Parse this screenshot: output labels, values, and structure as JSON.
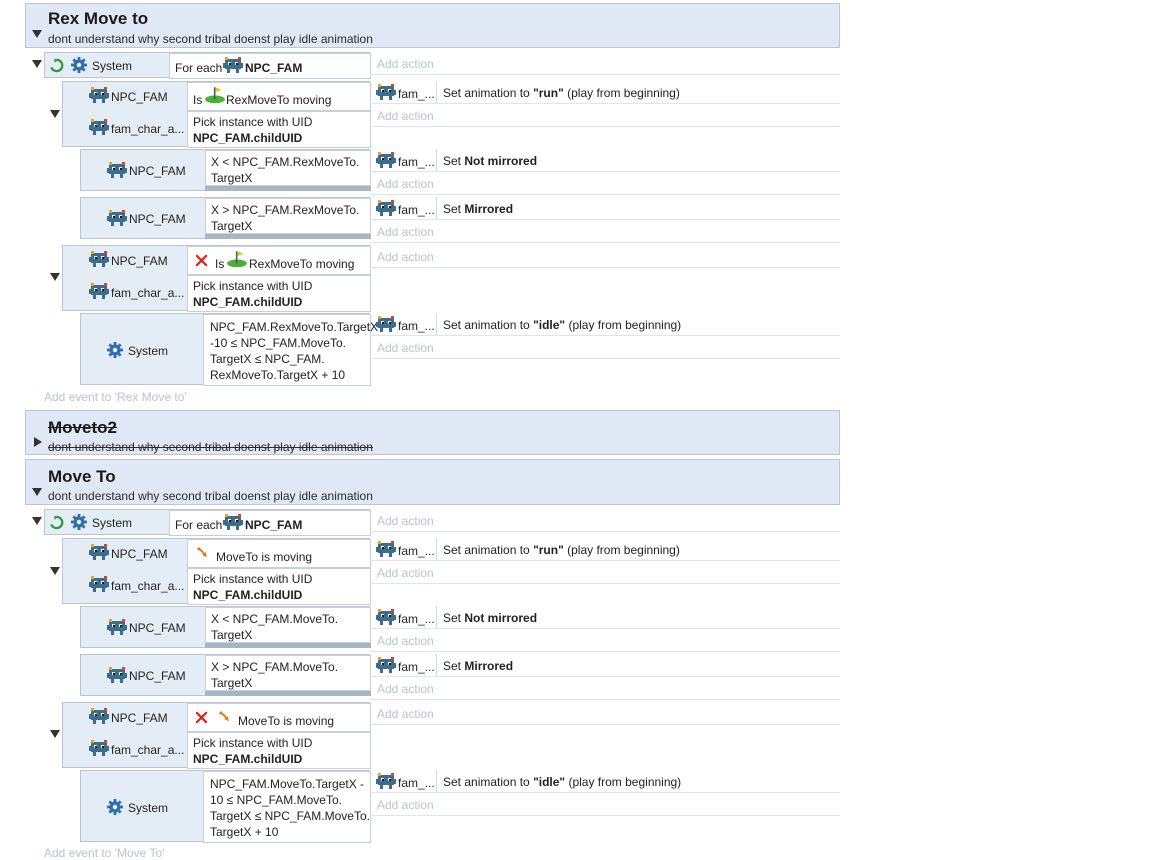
{
  "groups": [
    {
      "title": "Rex Move to",
      "description": "dont understand why second tribal doenst play idle animation"
    },
    {
      "title": "Moveto2",
      "description": "dont understand why second tribal doenst play idle animation",
      "disabled": true
    },
    {
      "title": "Move To",
      "description": "dont understand why second tribal doenst play idle animation"
    }
  ],
  "labels": {
    "system": "System",
    "for_each": "For each",
    "npc_fam": "NPC_FAM",
    "fam_char": "fam_char_a...",
    "fam_short": "fam_...",
    "add_action": "Add action",
    "is": "Is",
    "pick_uid": "Pick instance with UID",
    "child_uid": "NPC_FAM.childUID"
  },
  "rex": {
    "moving": "RexMoveTo moving",
    "run_pre": "Set animation to ",
    "run_val": "\"run\"",
    "run_post": " (play from beginning)",
    "c_lt_1": "X < NPC_FAM.RexMoveTo.",
    "c_lt_2": "TargetX",
    "c_gt_1": "X > NPC_FAM.RexMoveTo.",
    "c_gt_2": "TargetX",
    "set_pre": "Set ",
    "not_mirrored": "Not mirrored",
    "mirrored": "Mirrored",
    "range_1": "NPC_FAM.RexMoveTo.TargetX",
    "range_2": "-10 ≤ NPC_FAM.MoveTo.",
    "range_3": "TargetX ≤ NPC_FAM.",
    "range_4": "RexMoveTo.TargetX + 10",
    "idle_pre": "Set animation to ",
    "idle_val": "\"idle\"",
    "idle_post": " (play from beginning)",
    "add_event": "Add event to 'Rex Move to'"
  },
  "mt": {
    "moving": "MoveTo is moving",
    "c_lt_1": "X < NPC_FAM.MoveTo.",
    "c_lt_2": "TargetX",
    "c_gt_1": "X > NPC_FAM.MoveTo.",
    "c_gt_2": "TargetX",
    "range_1": "NPC_FAM.MoveTo.TargetX -",
    "range_2": "10 ≤ NPC_FAM.MoveTo.",
    "range_3": "TargetX ≤ NPC_FAM.MoveTo.",
    "range_4": "TargetX + 10",
    "add_event": "Add event to 'Move To'"
  },
  "colors": {
    "group_bg": "#dfe8f4",
    "block_bg": "#e4ecf5",
    "add_text": "#b8c4d4",
    "invert_x": "#e0201a"
  }
}
